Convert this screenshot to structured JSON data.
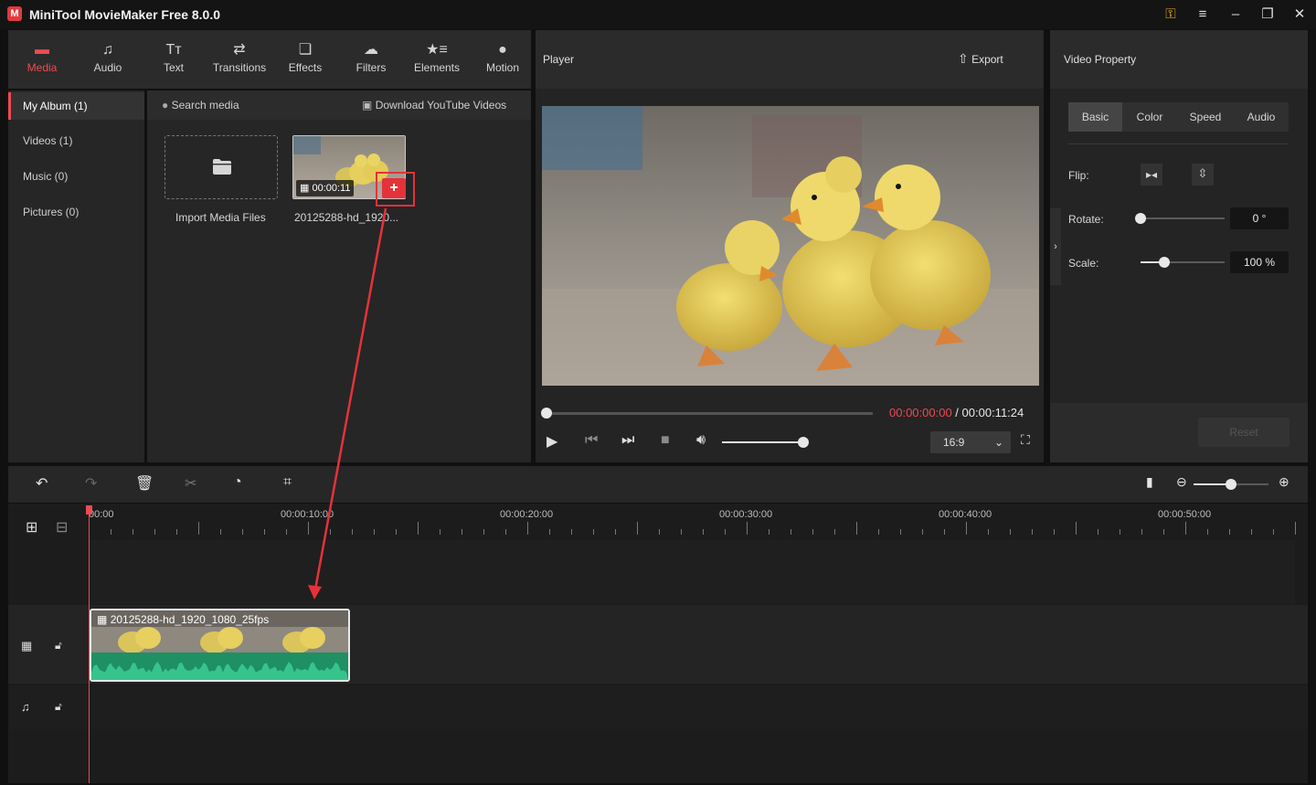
{
  "app": {
    "title": "MiniTool MovieMaker Free 8.0.0"
  },
  "toolbar": {
    "items": [
      {
        "label": "Media",
        "icon": "media-icon"
      },
      {
        "label": "Audio",
        "icon": "music-note-icon"
      },
      {
        "label": "Text",
        "icon": "text-icon"
      },
      {
        "label": "Transitions",
        "icon": "transitions-icon"
      },
      {
        "label": "Effects",
        "icon": "effects-icon"
      },
      {
        "label": "Filters",
        "icon": "filters-icon"
      },
      {
        "label": "Elements",
        "icon": "elements-icon"
      },
      {
        "label": "Motion",
        "icon": "motion-icon"
      }
    ]
  },
  "album": {
    "items": [
      "My Album (1)",
      "Videos (1)",
      "Music (0)",
      "Pictures (0)"
    ]
  },
  "media": {
    "search_placeholder": "Search media",
    "download_label": "Download YouTube Videos",
    "import_label": "Import Media Files",
    "clip_duration": "00:00:11",
    "clip_name": "20125288-hd_1920..."
  },
  "player": {
    "title": "Player",
    "export_label": "Export",
    "current_time": "00:00:00:00",
    "separator": " / ",
    "total_time": "00:00:11:24",
    "aspect_ratio": "16:9",
    "seek_progress": 0,
    "volume_level": 0.95
  },
  "property": {
    "title": "Video Property",
    "tabs": [
      "Basic",
      "Color",
      "Speed",
      "Audio"
    ],
    "flip_label": "Flip:",
    "rotate_label": "Rotate:",
    "rotate_value": "0 °",
    "rotate_level": 0,
    "scale_label": "Scale:",
    "scale_value": "100 %",
    "scale_level": 0.28,
    "reset_label": "Reset"
  },
  "timeline": {
    "ruler": [
      "00:00",
      "00:00:10:00",
      "00:00:20:00",
      "00:00:30:00",
      "00:00:40:00",
      "00:00:50:00"
    ],
    "clip_name": "20125288-hd_1920_1080_25fps",
    "zoom_level": 0.5
  },
  "colors": {
    "accent": "#ef4a52",
    "waveform": "#2bb07f"
  }
}
